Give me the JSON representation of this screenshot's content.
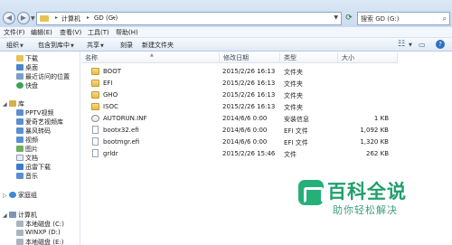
{
  "address_bar": {
    "breadcrumbs": [
      "计算机",
      "GD (G:)"
    ],
    "separator": "▸",
    "search_placeholder": "搜索 GD (G:)"
  },
  "menu": {
    "items": [
      "文件(F)",
      "编辑(E)",
      "查看(V)",
      "工具(T)",
      "帮助(H)"
    ]
  },
  "toolbar": {
    "organize": "组织",
    "include_in_library": "包含到库中",
    "share": "共享",
    "burn": "刻录",
    "new_folder": "新建文件夹"
  },
  "sidebar": {
    "favorites": [
      {
        "label": "下载",
        "icon": "download-folder-icon"
      },
      {
        "label": "桌面",
        "icon": "desktop-icon"
      },
      {
        "label": "最近访问的位置",
        "icon": "recent-places-icon"
      },
      {
        "label": "快盘",
        "icon": "kuaipan-icon"
      }
    ],
    "library_header": "库",
    "libraries": [
      {
        "label": "PPTV视频",
        "icon": "video-library-icon"
      },
      {
        "label": "爱奇艺视频库",
        "icon": "video-library-icon"
      },
      {
        "label": "暴风转码",
        "icon": "video-library-icon"
      },
      {
        "label": "视频",
        "icon": "video-icon"
      },
      {
        "label": "图片",
        "icon": "picture-icon"
      },
      {
        "label": "文档",
        "icon": "document-icon"
      },
      {
        "label": "迅雷下载",
        "icon": "thunder-icon"
      },
      {
        "label": "音乐",
        "icon": "music-icon"
      }
    ],
    "homegroup": "家庭组",
    "computer_header": "计算机",
    "drives": [
      "本地磁盘 (C:)",
      "WINXP (D:)",
      "本地磁盘 (E:)"
    ]
  },
  "file_list": {
    "columns": {
      "name": "名称",
      "date": "修改日期",
      "type": "类型",
      "size": "大小"
    },
    "rows": [
      {
        "name": "BOOT",
        "date": "2015/2/26 16:13",
        "type": "文件夹",
        "size": "",
        "icon": "folder-icon"
      },
      {
        "name": "EFI",
        "date": "2015/2/26 16:13",
        "type": "文件夹",
        "size": "",
        "icon": "folder-icon"
      },
      {
        "name": "GHO",
        "date": "2015/2/26 16:13",
        "type": "文件夹",
        "size": "",
        "icon": "folder-icon"
      },
      {
        "name": "ISOC",
        "date": "2015/2/26 16:13",
        "type": "文件夹",
        "size": "",
        "icon": "folder-icon"
      },
      {
        "name": "AUTORUN.INF",
        "date": "2014/6/6 0:00",
        "type": "安装信息",
        "size": "1 KB",
        "icon": "settings-file-icon"
      },
      {
        "name": "bootx32.efi",
        "date": "2014/6/6 0:00",
        "type": "EFI 文件",
        "size": "1,092 KB",
        "icon": "file-icon"
      },
      {
        "name": "bootmgr.efi",
        "date": "2014/6/6 0:00",
        "type": "EFI 文件",
        "size": "1,320 KB",
        "icon": "file-icon"
      },
      {
        "name": "grldr",
        "date": "2015/2/26 15:46",
        "type": "文件",
        "size": "262 KB",
        "icon": "file-icon"
      }
    ]
  },
  "watermark": {
    "title": "百科全说",
    "subtitle": "助你轻松解决"
  }
}
